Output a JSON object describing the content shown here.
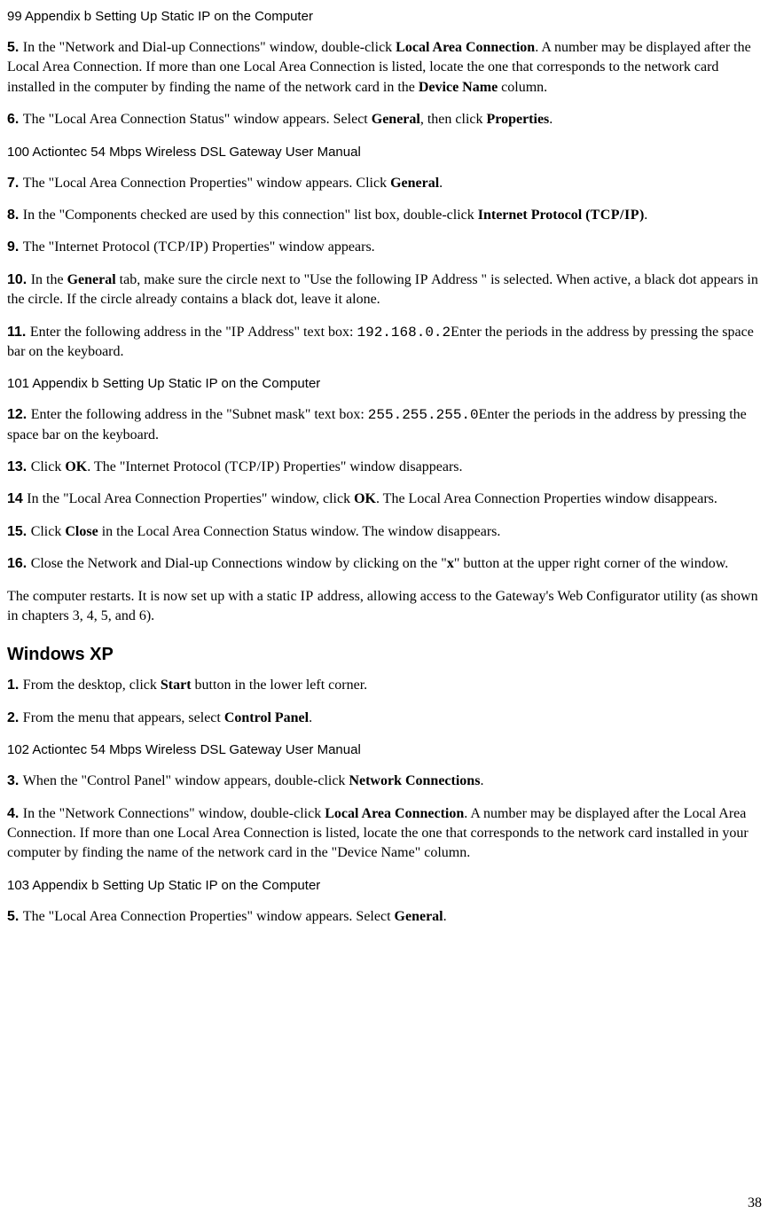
{
  "header99": "99 Appendix b Setting Up Static IP on the Computer",
  "header100": "100 Actiontec 54 Mbps Wireless DSL Gateway User Manual",
  "header101": "101 Appendix b Setting Up Static IP on the Computer",
  "header102": "102 Actiontec 54 Mbps Wireless DSL Gateway User Manual",
  "header103": "103 Appendix b Setting Up Static IP on the Computer",
  "s5": {
    "num": "5. ",
    "pre": "In the \"Network and Dial-up Connections\" window, double-click ",
    "b1": "Local Area Connection",
    "mid": ". A number may be displayed after the Local Area Connection. If more than one Local Area Connection is listed, locate the one that corresponds to the network card installed in the computer by finding the name of the network card in the ",
    "b2": "Device Name",
    "post": " column."
  },
  "s6": {
    "num": "6. ",
    "pre": "The \"Local Area Connection Status\" window appears. Select ",
    "b1": "General",
    "mid": ", then click ",
    "b2": "Properties",
    "post": "."
  },
  "s7": {
    "num": "7. ",
    "pre": "The \"Local Area Connection Properties\" window appears. Click ",
    "b1": "General",
    "post": "."
  },
  "s8": {
    "num": "8. ",
    "pre": "In the \"Components checked are used by this connection\" list box, double-click ",
    "b1": "Internet Protocol (",
    "sc": "TCP/IP",
    "b1post": ")",
    "post": "."
  },
  "s9": {
    "num": "9. ",
    "pre": "The \"Internet Protocol (",
    "sc": "TCP/IP",
    "post": ") Properties\" window appears."
  },
  "s10": {
    "num": "10. ",
    "pre": "In the ",
    "b1": "General",
    "mid": " tab, make sure the circle next to \"Use the following ",
    "sc": "IP",
    "post": " Address \" is selected. When active, a black dot appears in the circle. If the circle already contains a black dot, leave it alone."
  },
  "s11": {
    "num": "11. ",
    "pre": "Enter the following address in the \"",
    "sc": "IP",
    "mid": " Address\" text box: ",
    "mono": "192.168.0.2",
    "post": "Enter the periods in the address by pressing the space bar on the keyboard."
  },
  "s12": {
    "num": "12. ",
    "pre": "Enter the following address in the \"Subnet mask\" text box: ",
    "mono": "255.255.255.0",
    "post": "Enter the periods in the address by pressing the space bar on the keyboard."
  },
  "s13": {
    "num": "13. ",
    "pre": "Click ",
    "b1": "OK",
    "mid": ". The \"Internet Protocol (",
    "sc": "TCP/IP",
    "post": ") Properties\" window disappears."
  },
  "s14": {
    "num": "14 ",
    "pre": "In the \"Local Area Connection Properties\" window, click ",
    "b1": "OK",
    "post": ". The Local Area Connection Properties window disappears."
  },
  "s15": {
    "num": "15. ",
    "pre": "Click ",
    "b1": "Close",
    "post": " in the Local Area Connection Status window. The window disappears."
  },
  "s16": {
    "num": "16. ",
    "pre": "Close the Network and Dial-up Connections window by clicking on the \"",
    "b1": "x",
    "post": "\" button at the upper right corner of the window."
  },
  "restart": {
    "pre": "The computer restarts. It is now set up with a static ",
    "sc": "IP",
    "post": " address, allowing access to the Gateway's Web Configurator utility (as shown in chapters 3, 4, 5, and 6)."
  },
  "xp_heading": "Windows XP",
  "x1": {
    "num": "1. ",
    "pre": "From the desktop, click ",
    "b1": "Start",
    "post": " button in the lower left corner."
  },
  "x2": {
    "num": "2. ",
    "pre": "From the menu that appears, select ",
    "b1": "Control Panel",
    "post": "."
  },
  "x3": {
    "num": "3. ",
    "pre": "When the \"Control Panel\" window appears, double-click ",
    "b1": "Network Connections",
    "post": "."
  },
  "x4": {
    "num": "4. ",
    "pre": "In the \"Network Connections\" window, double-click ",
    "b1": "Local Area Connection",
    "post": ". A number may be displayed after the Local Area Connection. If more than one Local Area Connection is listed, locate the one that corresponds to the network card installed in your computer by finding the name of the network card in the \"Device Name\" column."
  },
  "x5": {
    "num": "5. ",
    "pre": "The \"Local Area Connection Properties\" window appears. Select ",
    "b1": "General",
    "post": "."
  },
  "page_number": "38"
}
